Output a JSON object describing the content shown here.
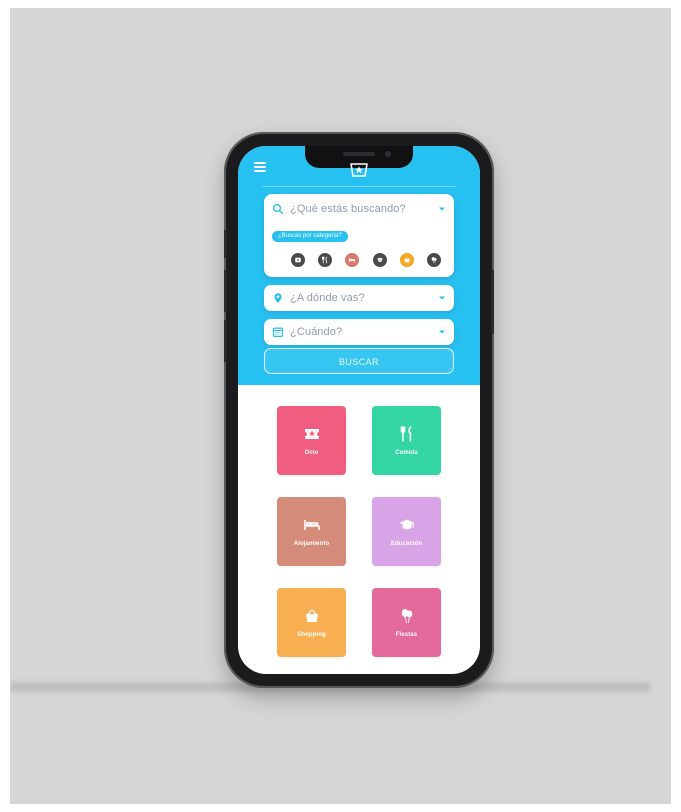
{
  "app": {
    "menu_icon": "hamburger-menu-icon",
    "logo_icon": "star-ticket-icon"
  },
  "search": {
    "what_placeholder": "¿Qué estás buscando?",
    "category_prompt": "¿Buscas por categoría?",
    "where_placeholder": "¿A dónde vas?",
    "when_placeholder": "¿Cuándo?",
    "search_button": "BUSCAR"
  },
  "category_icons": [
    {
      "name": "leisure-category-icon",
      "color": "#4a4a4a"
    },
    {
      "name": "food-category-icon",
      "color": "#4a4a4a"
    },
    {
      "name": "accommodation-category-icon",
      "color": "#d8786b"
    },
    {
      "name": "education-category-icon",
      "color": "#4a4a4a"
    },
    {
      "name": "shopping-category-icon",
      "color": "#f5a623"
    },
    {
      "name": "parties-category-icon",
      "color": "#4a4a4a"
    }
  ],
  "categories": [
    {
      "label": "Ocio",
      "color": "#f05d7e",
      "icon": "ticket-star-icon"
    },
    {
      "label": "Comida",
      "color": "#34d5a4",
      "icon": "fork-knife-icon"
    },
    {
      "label": "Alojamiento",
      "color": "#d58b79",
      "icon": "bed-icon"
    },
    {
      "label": "Educación",
      "color": "#d9a3e8",
      "icon": "graduation-cap-icon"
    },
    {
      "label": "Shopping",
      "color": "#f8af52",
      "icon": "shopping-basket-icon"
    },
    {
      "label": "Fiestas",
      "color": "#e46a9b",
      "icon": "balloons-icon"
    }
  ],
  "colors": {
    "primary": "#27c1f1",
    "input_icon": "#27c1f1",
    "placeholder": "#8d9bb0",
    "background": "#d6d6d6",
    "phone_body": "#1b1b1d"
  }
}
